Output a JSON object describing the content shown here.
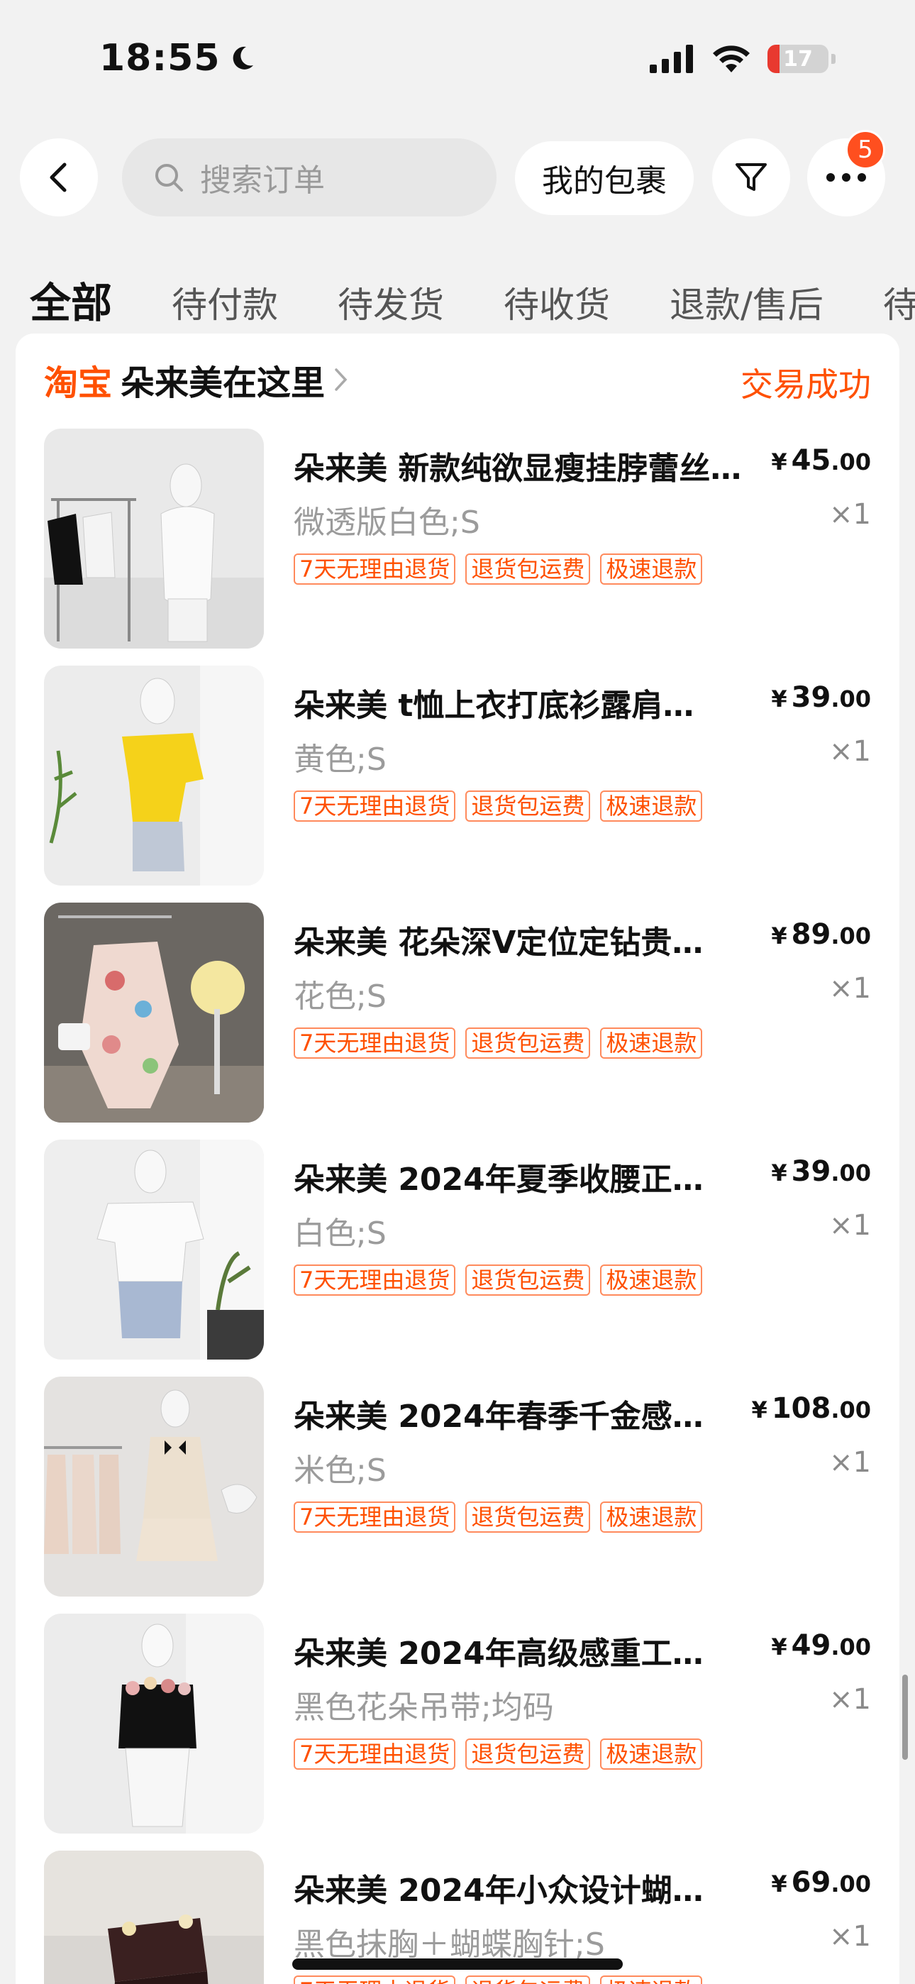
{
  "status_bar": {
    "time": "18:55",
    "battery": "17"
  },
  "search": {
    "placeholder": "搜索订单"
  },
  "nav": {
    "packages_label": "我的包裹",
    "more_badge": "5"
  },
  "tabs": [
    "全部",
    "待付款",
    "待发货",
    "待收货",
    "退款/售后",
    "待"
  ],
  "order": {
    "shop_logo": "淘宝",
    "shop_name": "朵来美在这里",
    "status": "交易成功",
    "items": [
      {
        "title": "朵来美 新款纯欲显瘦挂脖蕾丝…",
        "price_int": "45",
        "price_dec": ".00",
        "sku": "微透版白色;S",
        "qty": "×1"
      },
      {
        "title": "朵来美 t恤上衣打底衫露肩…",
        "price_int": "39",
        "price_dec": ".00",
        "sku": "黄色;S",
        "qty": "×1"
      },
      {
        "title": "朵来美 花朵深V定位定钻贵…",
        "price_int": "89",
        "price_dec": ".00",
        "sku": "花色;S",
        "qty": "×1"
      },
      {
        "title": "朵来美 2024年夏季收腰正…",
        "price_int": "39",
        "price_dec": ".00",
        "sku": "白色;S",
        "qty": "×1"
      },
      {
        "title": "朵来美 2024年春季千金感…",
        "price_int": "108",
        "price_dec": ".00",
        "sku": "米色;S",
        "qty": "×1"
      },
      {
        "title": "朵来美 2024年高级感重工…",
        "price_int": "49",
        "price_dec": ".00",
        "sku": "黑色花朵吊带;均码",
        "qty": "×1"
      },
      {
        "title": "朵来美 2024年小众设计蝴…",
        "price_int": "69",
        "price_dec": ".00",
        "sku": "黑色抹胸＋蝴蝶胸针;S",
        "qty": "×1"
      }
    ],
    "tags": [
      "7天无理由退货",
      "退货包运费",
      "极速退款"
    ],
    "currency": "¥"
  },
  "colors": {
    "accent": "#ff5000",
    "background": "#f2f2f2",
    "card": "#ffffff"
  },
  "icons": [
    "moon-icon",
    "signal-icon",
    "wifi-icon",
    "battery-icon",
    "back-chevron-icon",
    "search-icon",
    "filter-icon",
    "more-icon",
    "chevron-right-icon"
  ]
}
